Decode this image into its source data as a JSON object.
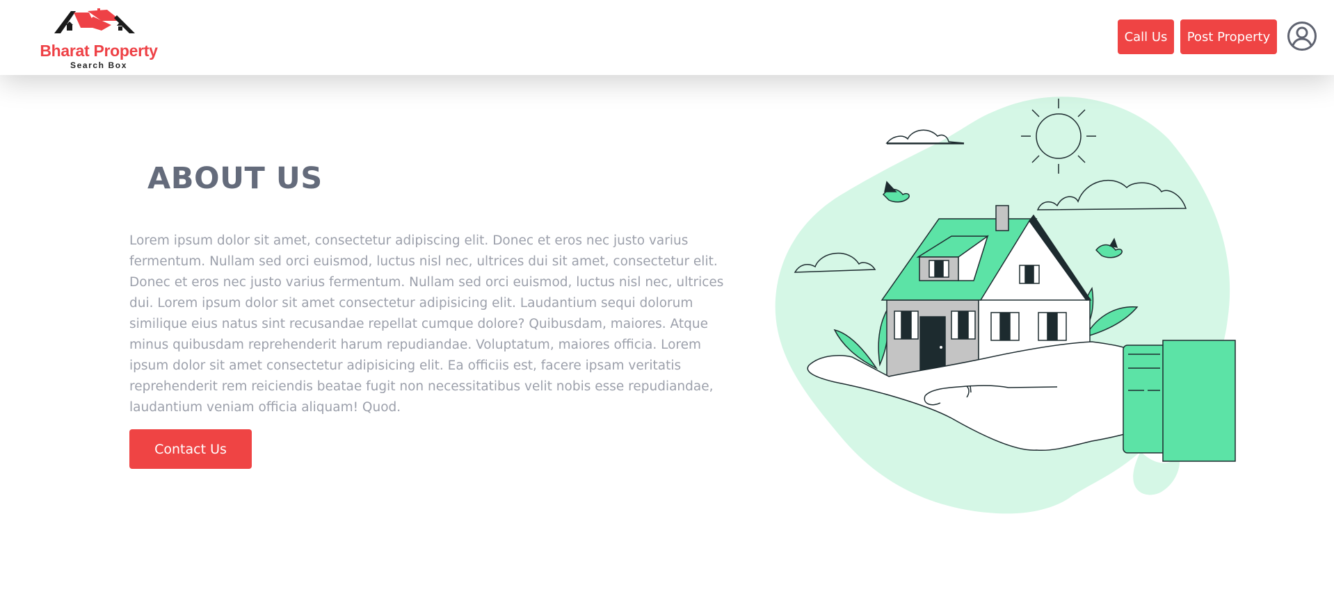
{
  "header": {
    "logo_title": "Bharat Property",
    "logo_subtitle": "Search Box",
    "call_label": "Call Us",
    "post_label": "Post Property",
    "user_icon": "user-circle-icon"
  },
  "about": {
    "title": "ABOUT US",
    "text": "Lorem ipsum dolor sit amet, consectetur adipiscing elit. Donec et eros nec justo varius fermentum. Nullam sed orci euismod, luctus nisl nec, ultrices dui sit amet, consectetur elit. Donec et eros nec justo varius fermentum. Nullam sed orci euismod, luctus nisl nec, ultrices dui. Lorem ipsum dolor sit amet consectetur adipisicing elit. Laudantium sequi dolorum similique eius natus sint recusandae repellat cumque dolore? Quibusdam, maiores. Atque minus quibusdam reprehenderit harum repudiandae. Voluptatum, maiores officia. Lorem ipsum dolor sit amet consectetur adipisicing elit. Ea officiis est, facere ipsam veritatis reprehenderit rem reiciendis beatae fugit non necessitatibus velit nobis esse repudiandae, laudantium veniam officia aliquam! Quod.",
    "contact_label": "Contact Us"
  },
  "colors": {
    "brand_red": "#ef4444",
    "mint": "#d5f7e6",
    "green": "#5ce3a6",
    "dark": "#1d2b2f"
  },
  "illustration": {
    "icon": "house-in-hand-illustration"
  }
}
